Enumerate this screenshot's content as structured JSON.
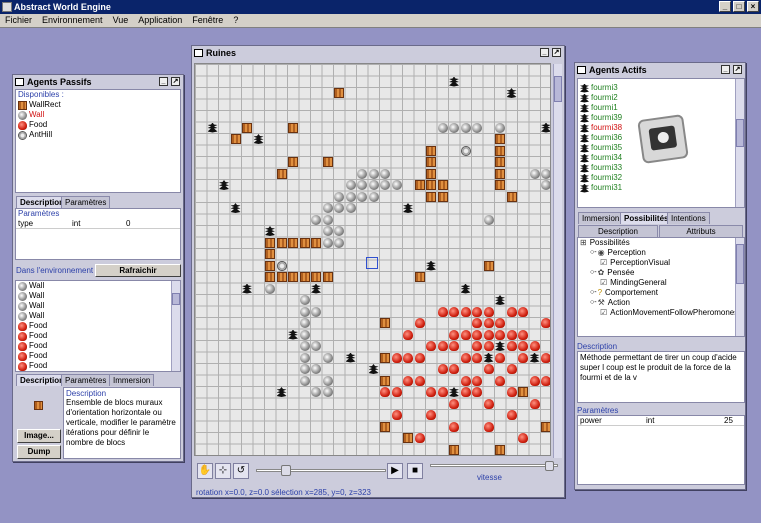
{
  "app": {
    "title": "Abstract World Engine",
    "menu": [
      "Fichier",
      "Environnement",
      "Vue",
      "Application",
      "Fenêtre",
      "?"
    ]
  },
  "passive": {
    "title": "Agents Passifs",
    "available_label": "Disponibles :",
    "available": [
      {
        "label": "WallRect",
        "icon": "wallrect",
        "color": "#000000"
      },
      {
        "label": "Wall",
        "icon": "wall",
        "color": "#d01010"
      },
      {
        "label": "Food",
        "icon": "food",
        "color": "#000000"
      },
      {
        "label": "AntHill",
        "icon": "anthill",
        "color": "#000000"
      }
    ],
    "tabs": [
      "Description",
      "Paramètres"
    ],
    "params_title": "Paramètres",
    "param_row": [
      "type",
      "int",
      "0"
    ],
    "env_label": "Dans l'environnement :",
    "refresh": "Rafraichir",
    "env_items": [
      {
        "label": "Wall",
        "icon": "wall"
      },
      {
        "label": "Wall",
        "icon": "wall"
      },
      {
        "label": "Wall",
        "icon": "wall"
      },
      {
        "label": "Wall",
        "icon": "wall"
      },
      {
        "label": "Food",
        "icon": "food"
      },
      {
        "label": "Food",
        "icon": "food"
      },
      {
        "label": "Food",
        "icon": "food"
      },
      {
        "label": "Food",
        "icon": "food"
      },
      {
        "label": "Food",
        "icon": "food"
      }
    ],
    "tabs2": [
      "Description",
      "Paramètres",
      "Immersion"
    ],
    "desc_title": "Description",
    "desc_text": "Ensemble de blocs muraux d'orientation horizontale ou verticale, modifier le paramètre itérations pour définir le nombre de blocs",
    "image_btn": "Image...",
    "dump_btn": "Dump"
  },
  "ruines": {
    "title": "Ruines",
    "status": "rotation  x=0.0, z=0.0  sélection  x=285, y=0, z=323",
    "speed_label": "vitesse",
    "speed_slider_fraction": 0.2,
    "speed_slider2_fraction": 0.97
  },
  "active": {
    "title": "Agents Actifs",
    "agents": [
      {
        "label": "fourmi3",
        "color": "#208020"
      },
      {
        "label": "fourmi2",
        "color": "#208020"
      },
      {
        "label": "fourmi1",
        "color": "#208020"
      },
      {
        "label": "fourmi39",
        "color": "#208020"
      },
      {
        "label": "fourmi38",
        "color": "#d01010"
      },
      {
        "label": "fourmi36",
        "color": "#208020"
      },
      {
        "label": "fourmi35",
        "color": "#208020"
      },
      {
        "label": "fourmi34",
        "color": "#208020"
      },
      {
        "label": "fourmi33",
        "color": "#208020"
      },
      {
        "label": "fourmi32",
        "color": "#208020"
      },
      {
        "label": "fourmi31",
        "color": "#208020"
      }
    ],
    "tabs": [
      "Immersion",
      "Possibilités",
      "Intentions"
    ],
    "subtabs": [
      "Description",
      "Attributs"
    ],
    "tree": [
      {
        "label": "Possibilités",
        "level": 0,
        "icon": "network"
      },
      {
        "label": "Perception",
        "level": 1,
        "icon": "eye"
      },
      {
        "label": "PerceptionVisual",
        "level": 2,
        "icon": "check"
      },
      {
        "label": "Pensée",
        "level": 1,
        "icon": "brain"
      },
      {
        "label": "MindingGeneral",
        "level": 2,
        "icon": "check"
      },
      {
        "label": "Comportement",
        "level": 1,
        "icon": "question"
      },
      {
        "label": "Action",
        "level": 1,
        "icon": "action"
      },
      {
        "label": "ActionMovementFollowPheromones",
        "level": 2,
        "icon": "check"
      }
    ],
    "desc_title": "Description",
    "desc_text": "Méthode permettant de tirer un coup d'acide super l coup est le produit de la force de la fourmi et de la v",
    "params_title": "Paramètres",
    "param_row": [
      "power",
      "int",
      "25"
    ]
  }
}
